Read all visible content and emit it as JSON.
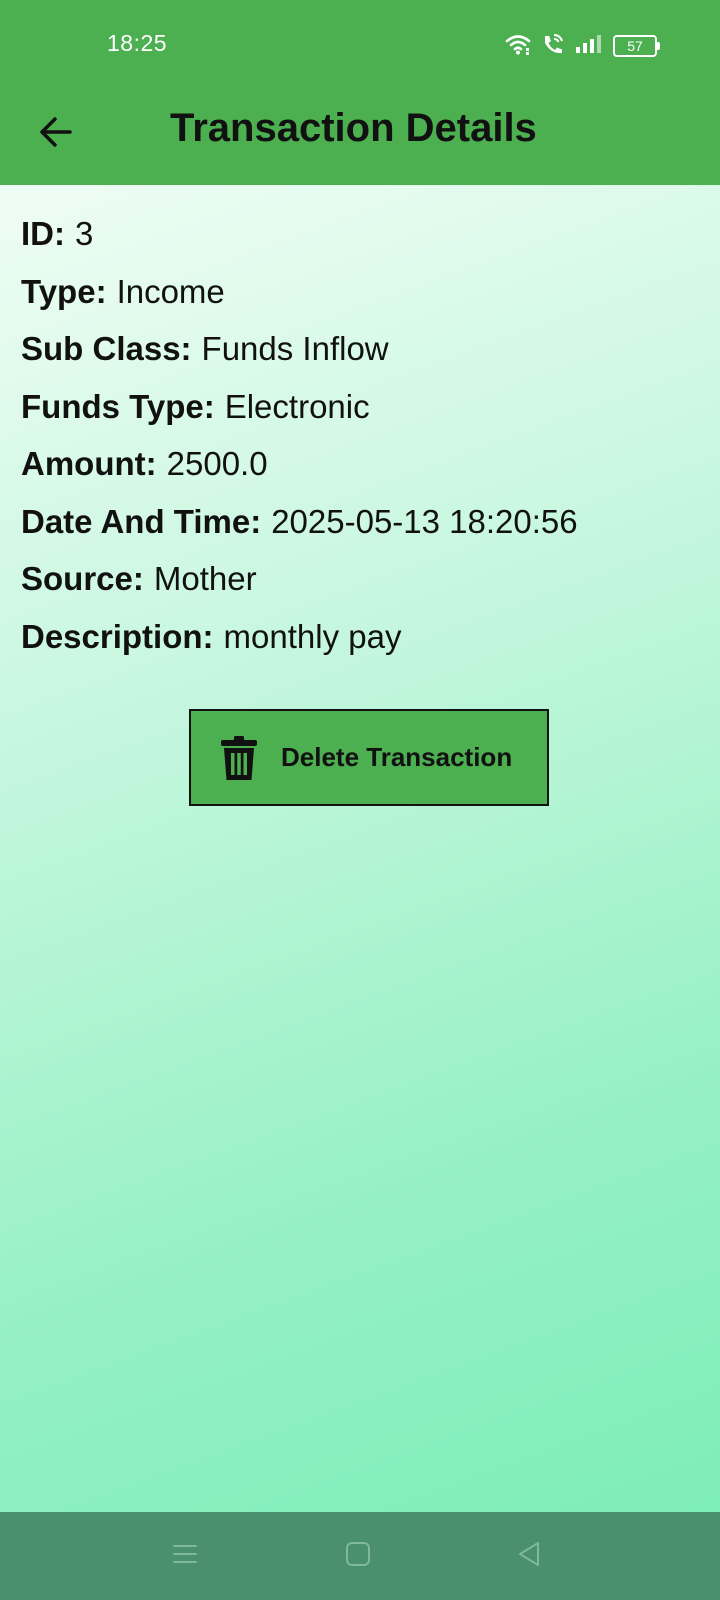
{
  "status_bar": {
    "time": "18:25",
    "battery": "57",
    "icons": [
      "wifi-icon",
      "wifi-calling-icon",
      "signal-icon",
      "battery-icon"
    ]
  },
  "app_bar": {
    "title": "Transaction Details",
    "back_icon": "arrow-back-icon"
  },
  "details": [
    {
      "label": "ID:",
      "value": "3"
    },
    {
      "label": "Type:",
      "value": "Income"
    },
    {
      "label": "Sub Class:",
      "value": "Funds Inflow"
    },
    {
      "label": "Funds Type:",
      "value": "Electronic"
    },
    {
      "label": "Amount:",
      "value": "2500.0"
    },
    {
      "label": "Date And Time:",
      "value": "2025-05-13 18:20:56"
    },
    {
      "label": "Source:",
      "value": "Mother"
    },
    {
      "label": "Description:",
      "value": "monthly pay"
    }
  ],
  "delete_button": {
    "label": "Delete Transaction",
    "icon": "trash-icon"
  },
  "nav_bar": {
    "icons": [
      "recent-apps-icon",
      "home-icon",
      "back-triangle-icon"
    ]
  },
  "colors": {
    "primary": "#4caf50",
    "nav_bar": "#4a8f6e",
    "gradient_start": "#effdf4",
    "gradient_end": "#7eeeb8",
    "text": "#111111"
  }
}
